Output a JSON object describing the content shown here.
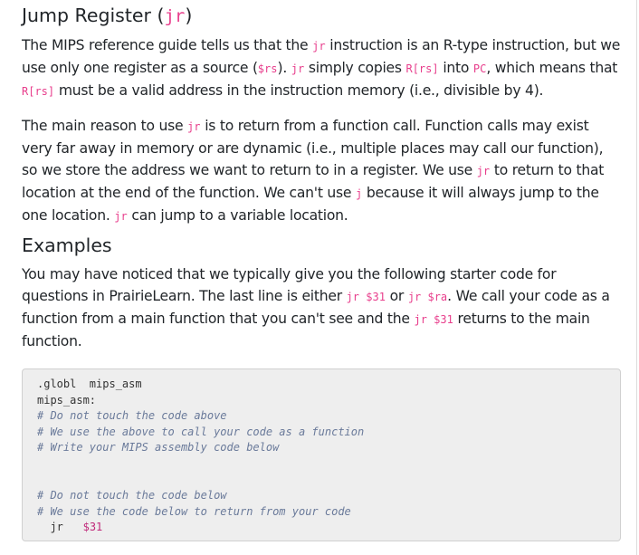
{
  "section1": {
    "title": "Jump Register",
    "title_paren_open": "(",
    "title_code": "jr",
    "title_paren_close": ")",
    "para1": [
      {
        "t": "text",
        "v": "The MIPS reference guide tells us that the "
      },
      {
        "t": "code",
        "v": "jr"
      },
      {
        "t": "text",
        "v": " instruction is an R-type instruction, but we use only one register as a source ("
      },
      {
        "t": "code",
        "v": "$rs"
      },
      {
        "t": "text",
        "v": "). "
      },
      {
        "t": "code",
        "v": "jr"
      },
      {
        "t": "text",
        "v": " simply copies "
      },
      {
        "t": "code",
        "v": "R[rs]"
      },
      {
        "t": "text",
        "v": " into "
      },
      {
        "t": "code",
        "v": "PC"
      },
      {
        "t": "text",
        "v": ", which means that "
      },
      {
        "t": "code",
        "v": "R[rs]"
      },
      {
        "t": "text",
        "v": " must be a valid address in the instruction memory (i.e., divisible by 4)."
      }
    ],
    "para2": [
      {
        "t": "text",
        "v": "The main reason to use "
      },
      {
        "t": "code",
        "v": "jr"
      },
      {
        "t": "text",
        "v": " is to return from a function call. Function calls may exist very far away in memory or are dynamic (i.e., multiple places may call our function), so we store the address we want to return to in a register. We use "
      },
      {
        "t": "code",
        "v": "jr"
      },
      {
        "t": "text",
        "v": " to return to that location at the end of the function. We can't use "
      },
      {
        "t": "code",
        "v": "j"
      },
      {
        "t": "text",
        "v": " because it will always jump to the one location. "
      },
      {
        "t": "code",
        "v": "jr"
      },
      {
        "t": "text",
        "v": " can jump to a variable location."
      }
    ]
  },
  "section2": {
    "title": "Examples",
    "para1": [
      {
        "t": "text",
        "v": "You may have noticed that we typically give you the following starter code for questions in PrairieLearn. The last line is either "
      },
      {
        "t": "code",
        "v": "jr $31"
      },
      {
        "t": "text",
        "v": " or "
      },
      {
        "t": "code",
        "v": "jr $ra"
      },
      {
        "t": "text",
        "v": ". We call your code as a function from a main function that you can't see and the "
      },
      {
        "t": "code",
        "v": "jr $31"
      },
      {
        "t": "text",
        "v": " returns to the main function."
      }
    ],
    "code_lines": [
      {
        "kind": "plain",
        "text": ".globl  mips_asm"
      },
      {
        "kind": "plain",
        "text": "mips_asm:"
      },
      {
        "kind": "comment",
        "text": "# Do not touch the code above"
      },
      {
        "kind": "comment",
        "text": "# We use the above to call your code as a function"
      },
      {
        "kind": "comment",
        "text": "# Write your MIPS assembly code below"
      },
      {
        "kind": "blank",
        "text": ""
      },
      {
        "kind": "blank",
        "text": ""
      },
      {
        "kind": "comment",
        "text": "# Do not touch the code below"
      },
      {
        "kind": "comment",
        "text": "# We use the code below to return from your code"
      },
      {
        "kind": "instr",
        "op": "  jr",
        "gap": "   ",
        "reg": "$31"
      }
    ]
  }
}
